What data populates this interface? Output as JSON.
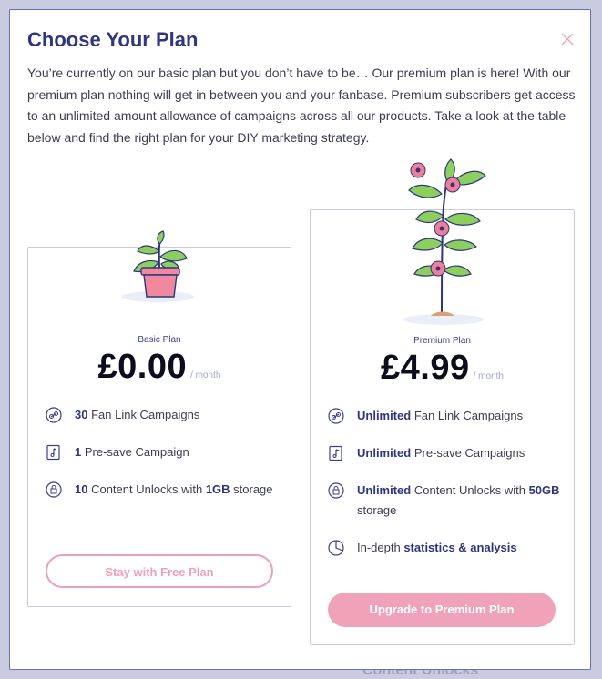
{
  "modal": {
    "title": "Choose Your Plan",
    "intro": "You’re currently on our basic plan but you don’t have to be… Our premium plan is here! With our premium plan nothing will get in between you and your fanbase. Premium subscribers get access to an unlimited amount allowance of campaigns across all our products. Take a look at the table below and find the right plan for your DIY marketing strategy."
  },
  "background": {
    "content_unlocks": "Content Unlocks"
  },
  "basic": {
    "name": "Basic Plan",
    "price": "£0.00",
    "per": "/ month",
    "features": [
      {
        "icon": "link-icon",
        "strong": "30",
        "text": " Fan Link Campaigns"
      },
      {
        "icon": "presave-icon",
        "strong": "1",
        "text": " Pre-save Campaign"
      },
      {
        "icon": "lock-icon",
        "strong": "10",
        "text": " Content Unlocks with ",
        "strong2": "1GB",
        "text2": " storage"
      }
    ],
    "button": "Stay with Free Plan"
  },
  "premium": {
    "name": "Premium Plan",
    "price": "£4.99",
    "per": "/ month",
    "features": [
      {
        "icon": "link-icon",
        "strong": "Unlimited",
        "text": " Fan Link Campaigns"
      },
      {
        "icon": "presave-icon",
        "strong": "Unlimited",
        "text": " Pre-save Campaigns"
      },
      {
        "icon": "lock-icon",
        "strong": "Unlimited",
        "text": " Content Unlocks with ",
        "strong2": "50GB",
        "text2": " storage"
      },
      {
        "icon": "pie-chart-icon",
        "text0": "In-depth ",
        "strong": "statistics & analysis"
      }
    ],
    "button": "Upgrade to Premium Plan"
  },
  "colors": {
    "title": "#2f3580",
    "accent_pink": "#f0a3b8",
    "border": "#c9cbe2"
  }
}
